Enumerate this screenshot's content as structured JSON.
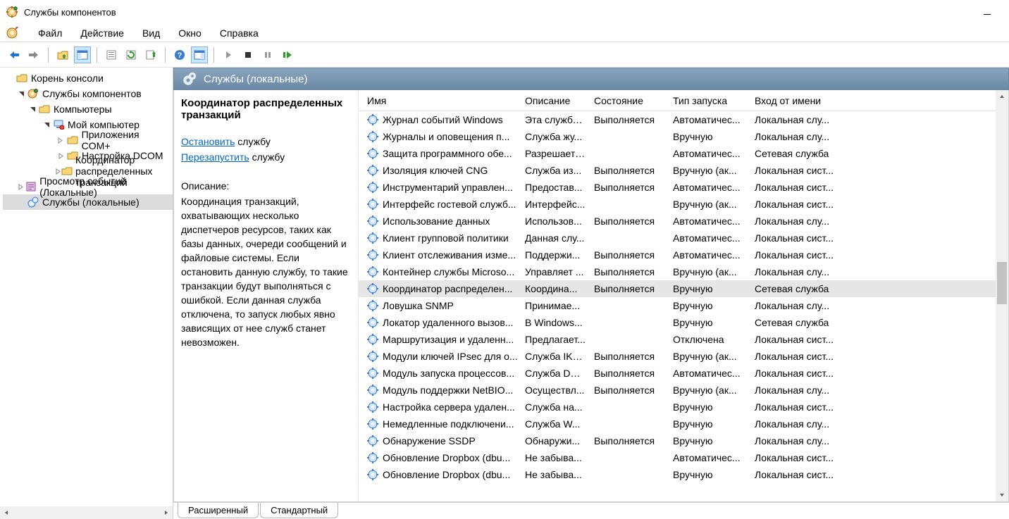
{
  "window": {
    "title": "Службы компонентов"
  },
  "menu": {
    "file": "Файл",
    "action": "Действие",
    "view": "Вид",
    "window": "Окно",
    "help": "Справка"
  },
  "tree": {
    "root": "Корень консоли",
    "svc_comp": "Службы компонентов",
    "computers": "Компьютеры",
    "my_computer": "Мой компьютер",
    "com_apps": "Приложения COM+",
    "dcom_config": "Настройка DCOM",
    "coord": "Координатор распределенных транзакций",
    "event_viewer": "Просмотр событий (Локальные)",
    "services_local": "Службы (локальные)"
  },
  "panel": {
    "title": "Службы (локальные)"
  },
  "detail": {
    "title": "Координатор распределенных транзакций",
    "stop_link": "Остановить",
    "stop_suffix": " службу",
    "restart_link": "Перезапустить",
    "restart_suffix": " службу",
    "desc_label": "Описание:",
    "desc_text": "Координация транзакций, охватывающих несколько диспетчеров ресурсов, таких как базы данных, очереди сообщений и файловые системы. Если остановить данную службу, то такие транзакции будут выполняться с ошибкой. Если данная служба отключена, то запуск любых явно зависящих от нее служб станет невозможен."
  },
  "columns": {
    "name": "Имя",
    "desc": "Описание",
    "state": "Состояние",
    "start": "Тип запуска",
    "logon": "Вход от имени"
  },
  "tabs": {
    "extended": "Расширенный",
    "standard": "Стандартный"
  },
  "services": [
    {
      "name": "Журнал событий Windows",
      "desc": "Эта служба...",
      "state": "Выполняется",
      "start": "Автоматичес...",
      "logon": "Локальная слу..."
    },
    {
      "name": "Журналы и оповещения п...",
      "desc": "Служба жу...",
      "state": "",
      "start": "Вручную",
      "logon": "Локальная слу..."
    },
    {
      "name": "Защита программного обе...",
      "desc": "Разрешает ...",
      "state": "",
      "start": "Автоматичес...",
      "logon": "Сетевая служба"
    },
    {
      "name": "Изоляция ключей CNG",
      "desc": "Служба из...",
      "state": "Выполняется",
      "start": "Вручную (ак...",
      "logon": "Локальная сист..."
    },
    {
      "name": "Инструментарий управлен...",
      "desc": "Предостав...",
      "state": "Выполняется",
      "start": "Автоматичес...",
      "logon": "Локальная сист..."
    },
    {
      "name": "Интерфейс гостевой служб...",
      "desc": "Интерфейс...",
      "state": "",
      "start": "Вручную (ак...",
      "logon": "Локальная сист..."
    },
    {
      "name": "Использование данных",
      "desc": "Использов...",
      "state": "Выполняется",
      "start": "Автоматичес...",
      "logon": "Локальная слу..."
    },
    {
      "name": "Клиент групповой политики",
      "desc": "Данная слу...",
      "state": "",
      "start": "Автоматичес...",
      "logon": "Локальная сист..."
    },
    {
      "name": "Клиент отслеживания изме...",
      "desc": "Поддержи...",
      "state": "Выполняется",
      "start": "Автоматичес...",
      "logon": "Локальная сист..."
    },
    {
      "name": "Контейнер службы Microso...",
      "desc": "Управляет ...",
      "state": "Выполняется",
      "start": "Вручную (ак...",
      "logon": "Локальная слу..."
    },
    {
      "name": "Координатор распределен...",
      "desc": "Координа...",
      "state": "Выполняется",
      "start": "Вручную",
      "logon": "Сетевая служба",
      "selected": true
    },
    {
      "name": "Ловушка SNMP",
      "desc": "Принимае...",
      "state": "",
      "start": "Вручную",
      "logon": "Локальная слу..."
    },
    {
      "name": "Локатор удаленного вызов...",
      "desc": "В Windows...",
      "state": "",
      "start": "Вручную",
      "logon": "Сетевая служба"
    },
    {
      "name": "Маршрутизация и удаленн...",
      "desc": "Предлагает...",
      "state": "",
      "start": "Отключена",
      "logon": "Локальная сист..."
    },
    {
      "name": "Модули ключей IPsec для о...",
      "desc": "Служба IKE...",
      "state": "Выполняется",
      "start": "Вручную (ак...",
      "logon": "Локальная сист..."
    },
    {
      "name": "Модуль запуска процессов...",
      "desc": "Служба DC...",
      "state": "Выполняется",
      "start": "Автоматичес...",
      "logon": "Локальная сист..."
    },
    {
      "name": "Модуль поддержки NetBIO...",
      "desc": "Осуществл...",
      "state": "Выполняется",
      "start": "Вручную (ак...",
      "logon": "Локальная слу..."
    },
    {
      "name": "Настройка сервера удален...",
      "desc": "Служба на...",
      "state": "",
      "start": "Вручную",
      "logon": "Локальная сист..."
    },
    {
      "name": "Немедленные подключени...",
      "desc": "Служба W...",
      "state": "",
      "start": "Вручную",
      "logon": "Локальная слу..."
    },
    {
      "name": "Обнаружение SSDP",
      "desc": "Обнаружи...",
      "state": "Выполняется",
      "start": "Вручную",
      "logon": "Локальная слу..."
    },
    {
      "name": "Обновление Dropbox (dbu...",
      "desc": "Не забыва...",
      "state": "",
      "start": "Автоматичес...",
      "logon": "Локальная сист..."
    },
    {
      "name": "Обновление Dropbox (dbu...",
      "desc": "Не забыва...",
      "state": "",
      "start": "Вручную",
      "logon": "Локальная сист..."
    }
  ]
}
